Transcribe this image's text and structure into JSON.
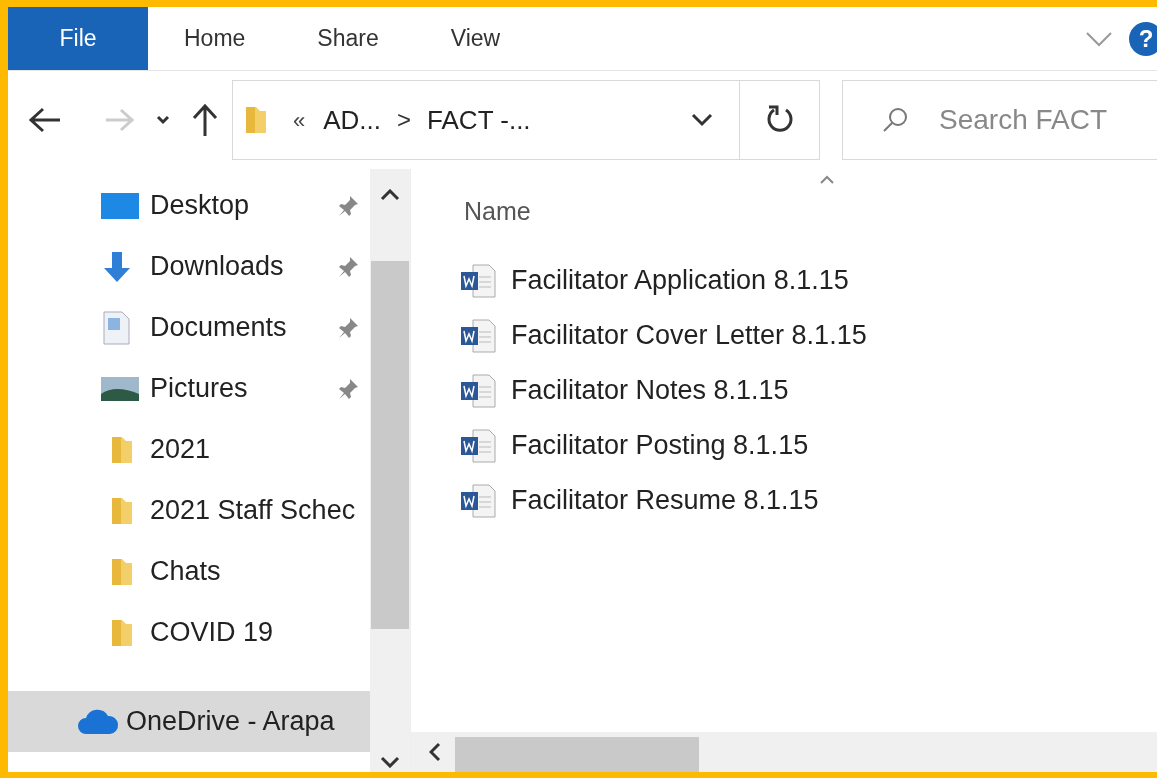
{
  "ribbon": {
    "tabs": [
      {
        "label": "File",
        "selected": true
      },
      {
        "label": "Home",
        "selected": false
      },
      {
        "label": "Share",
        "selected": false
      },
      {
        "label": "View",
        "selected": false
      }
    ],
    "help": "?"
  },
  "address_bar": {
    "overflow": "«",
    "crumbs": [
      "AD...",
      "FACT -..."
    ],
    "separator": ">"
  },
  "search": {
    "placeholder": "Search FACT"
  },
  "sidebar": {
    "items": [
      {
        "label": "Desktop",
        "kind": "desktop",
        "pinned": true,
        "selected": false
      },
      {
        "label": "Downloads",
        "kind": "downloads",
        "pinned": true,
        "selected": false
      },
      {
        "label": "Documents",
        "kind": "documents",
        "pinned": true,
        "selected": false
      },
      {
        "label": "Pictures",
        "kind": "pictures",
        "pinned": true,
        "selected": false
      },
      {
        "label": "2021",
        "kind": "folder",
        "pinned": false,
        "selected": false
      },
      {
        "label": "2021 Staff Schec",
        "kind": "folder",
        "pinned": false,
        "selected": false
      },
      {
        "label": "Chats",
        "kind": "folder",
        "pinned": false,
        "selected": false
      },
      {
        "label": "COVID 19",
        "kind": "folder",
        "pinned": false,
        "selected": false
      },
      {
        "label": "OneDrive - Arapa",
        "kind": "cloud",
        "pinned": false,
        "selected": true
      }
    ]
  },
  "file_list": {
    "columns": [
      "Name"
    ],
    "files": [
      {
        "name": "Facilitator Application 8.1.15"
      },
      {
        "name": "Facilitator Cover Letter 8.1.15"
      },
      {
        "name": "Facilitator Notes 8.1.15"
      },
      {
        "name": "Facilitator Posting 8.1.15"
      },
      {
        "name": "Facilitator Resume 8.1.15"
      }
    ]
  }
}
